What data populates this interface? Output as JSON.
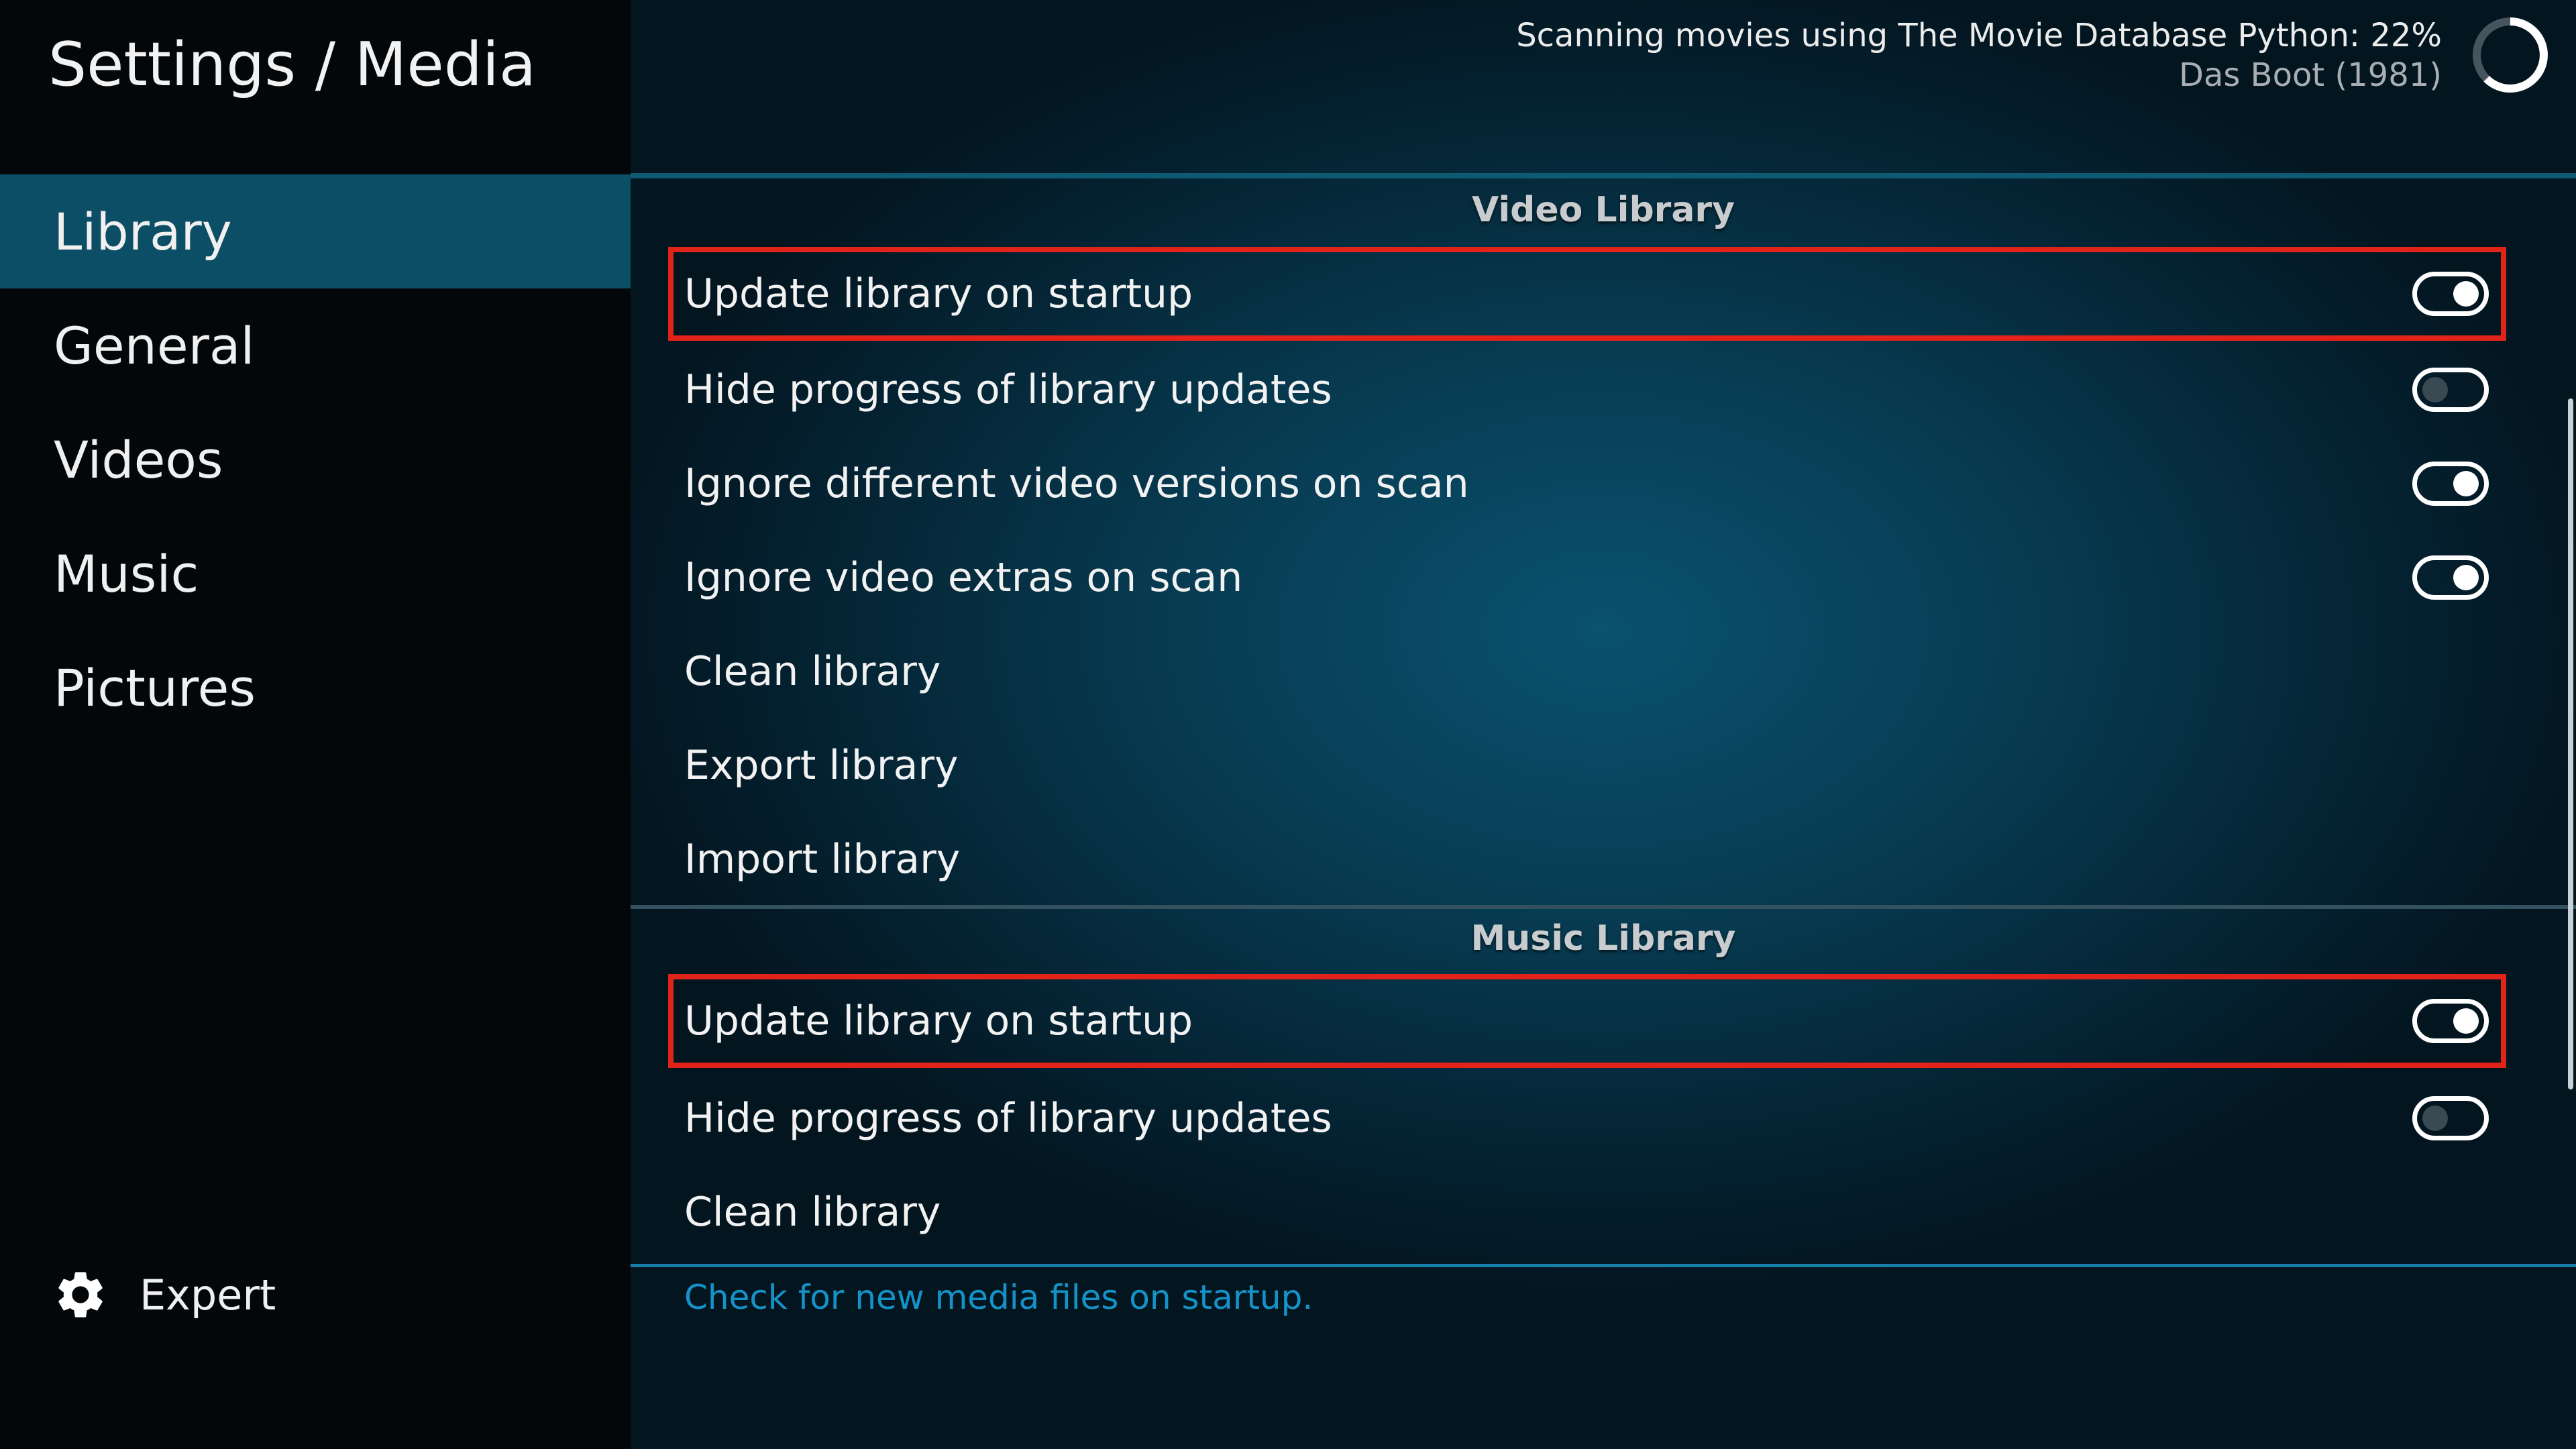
{
  "header": {
    "title": "Settings / Media"
  },
  "sidebar": {
    "items": [
      {
        "label": "Library",
        "selected": true
      },
      {
        "label": "General",
        "selected": false
      },
      {
        "label": "Videos",
        "selected": false
      },
      {
        "label": "Music",
        "selected": false
      },
      {
        "label": "Pictures",
        "selected": false
      }
    ],
    "expert_label": "Expert",
    "expert_icon": "gear-icon"
  },
  "scan_status": {
    "title": "Scanning movies using The Movie Database Python: 22%",
    "progress_percent": 22,
    "item": "Das Boot (1981)"
  },
  "video_library": {
    "header": "Video Library",
    "items": [
      {
        "label": "Update library on startup",
        "toggle": "on",
        "highlighted": true
      },
      {
        "label": "Hide progress of library updates",
        "toggle": "off"
      },
      {
        "label": "Ignore different video versions on scan",
        "toggle": "on"
      },
      {
        "label": "Ignore video extras on scan",
        "toggle": "on"
      },
      {
        "label": "Clean library"
      },
      {
        "label": "Export library"
      },
      {
        "label": "Import library"
      }
    ]
  },
  "music_library": {
    "header": "Music Library",
    "items": [
      {
        "label": "Update library on startup",
        "toggle": "on",
        "highlighted": true
      },
      {
        "label": "Hide progress of library updates",
        "toggle": "off"
      },
      {
        "label": "Clean library"
      }
    ]
  },
  "description": "Check for new media files on startup.",
  "colors": {
    "sidebar_selected": "#0c4e65",
    "highlight_border": "#e2231a",
    "description_text": "#1593c9"
  }
}
